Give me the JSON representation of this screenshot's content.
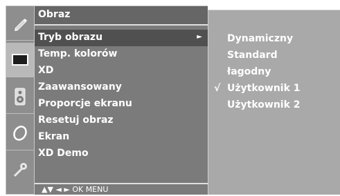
{
  "sidebar": {
    "icons": [
      {
        "name": "pencil-icon"
      },
      {
        "name": "monitor-icon"
      },
      {
        "name": "speaker-icon"
      },
      {
        "name": "clock-icon"
      },
      {
        "name": "key-icon"
      }
    ],
    "active_index": 1
  },
  "menu": {
    "title": "Obraz",
    "items": [
      {
        "label": "Tryb obrazu",
        "arrow": "►"
      },
      {
        "label": "Temp. kolorów"
      },
      {
        "label": "XD"
      },
      {
        "label": "Zaawansowany"
      },
      {
        "label": "Proporcje ekranu"
      },
      {
        "label": "Resetuj obraz"
      },
      {
        "label": "Ekran"
      },
      {
        "label": "XD Demo"
      }
    ],
    "selected_index": 0,
    "hint": "▲▼  ◄ ►  OK  MENU"
  },
  "submenu": {
    "items": [
      {
        "label": "Dynamiczny",
        "check": ""
      },
      {
        "label": "Standard",
        "check": ""
      },
      {
        "label": "łagodny",
        "check": ""
      },
      {
        "label": "Użytkownik 1",
        "check": "√"
      },
      {
        "label": "Użytkownik 2",
        "check": ""
      }
    ]
  },
  "colors": {
    "icon_column": "#8e8e8e",
    "main_panel": "#7b7b7b",
    "selected_row": "#505050",
    "sub_panel": "#a9a9a9",
    "text": "#ffffff"
  }
}
